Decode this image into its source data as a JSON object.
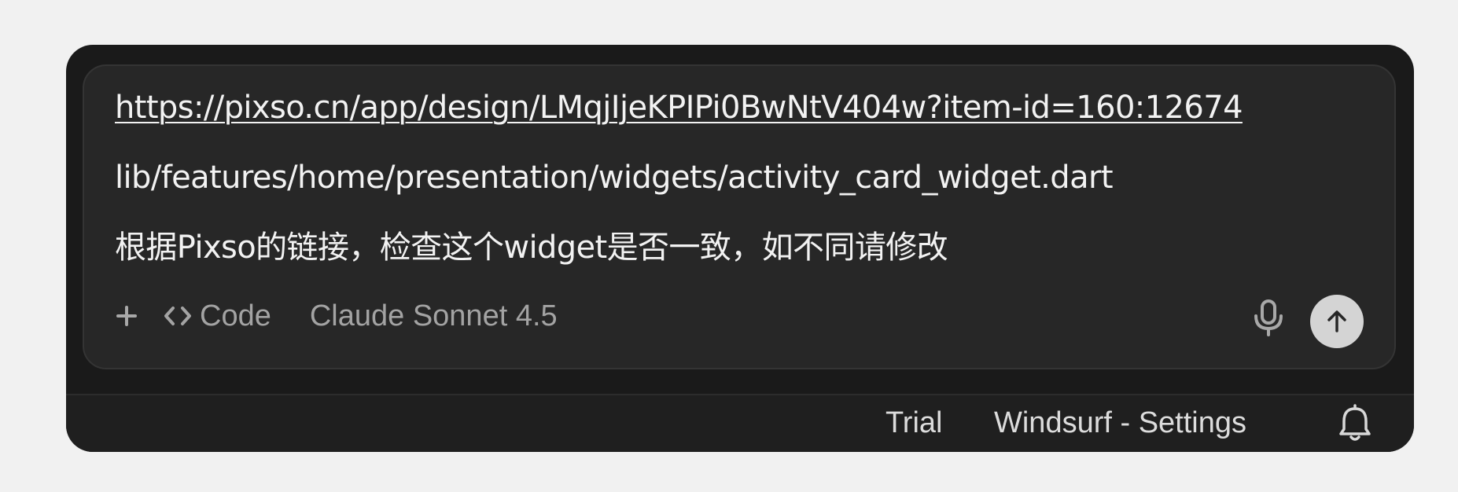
{
  "composer": {
    "message_lines": [
      "https://pixso.cn/app/design/LMqjIjeKPIPi0BwNtV404w?item-id=160:12674",
      "lib/features/home/presentation/widgets/activity_card_widget.dart",
      "根据Pixso的链接，检查这个widget是否一致，如不同请修改"
    ],
    "toolbar": {
      "add_icon": "plus-icon",
      "mode_icon": "code-brackets-icon",
      "mode_label": "Code",
      "model_label": "Claude Sonnet 4.5",
      "mic_icon": "microphone-icon",
      "send_icon": "arrow-up-icon"
    }
  },
  "status_bar": {
    "trial_label": "Trial",
    "settings_label": "Windsurf - Settings",
    "notification_icon": "bell-icon"
  },
  "colors": {
    "page_background": "#f1f1f1",
    "window_background": "#1a1a1a",
    "composer_background": "#272727",
    "text_primary": "#f2f2f2",
    "text_muted": "#a3a3a3",
    "send_button": "#d4d4d4"
  }
}
